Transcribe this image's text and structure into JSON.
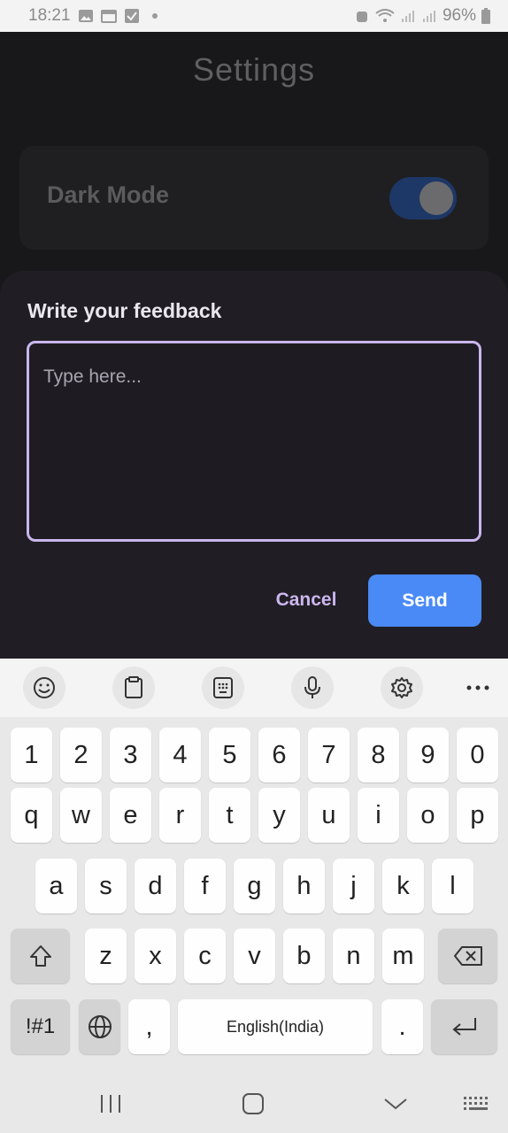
{
  "status_bar": {
    "time": "18:21",
    "battery": "96%"
  },
  "app": {
    "title": "Settings",
    "dark_mode": {
      "label": "Dark Mode",
      "enabled": true
    }
  },
  "feedback_sheet": {
    "title": "Write your feedback",
    "placeholder": "Type here...",
    "value": "",
    "cancel_label": "Cancel",
    "send_label": "Send"
  },
  "keyboard": {
    "toolbar": [
      "emoji-icon",
      "clipboard-icon",
      "keypad-icon",
      "microphone-icon",
      "settings-icon",
      "more-icon"
    ],
    "number_row": [
      "1",
      "2",
      "3",
      "4",
      "5",
      "6",
      "7",
      "8",
      "9",
      "0"
    ],
    "row1": [
      "q",
      "w",
      "e",
      "r",
      "t",
      "y",
      "u",
      "i",
      "o",
      "p"
    ],
    "row2": [
      "a",
      "s",
      "d",
      "f",
      "g",
      "h",
      "j",
      "k",
      "l"
    ],
    "row3": [
      "z",
      "x",
      "c",
      "v",
      "b",
      "n",
      "m"
    ],
    "symbols_label": "!#1",
    "comma": ",",
    "space_label": "English(India)",
    "period": "."
  },
  "nav_bar": [
    "recents-icon",
    "home-icon",
    "back-icon",
    "keyboard-icon"
  ],
  "colors": {
    "accent_outline": "#cbb6ee",
    "send_button": "#4a8af6",
    "toggle_track": "#1d3766"
  }
}
